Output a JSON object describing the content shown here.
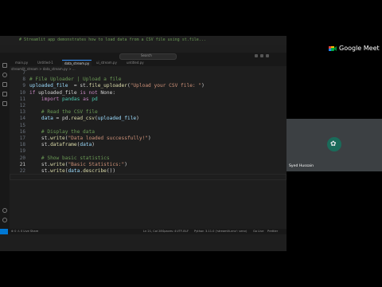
{
  "meet": {
    "brand": "Google Meet",
    "participant_name": "Syed Hussain"
  },
  "vscode": {
    "top_comment": "# Streamlit app demonstrates how to load data from a CSV file using st.file...",
    "command_center": "Search",
    "tabs": [
      "main.py",
      "Untitled-1",
      "data_stream.py",
      "ui_stream.py",
      "untitled.py"
    ],
    "active_tab": 2,
    "breadcrumb": "streamlit_stream > data_stream.py > ...",
    "status": {
      "remote": "",
      "left": "⊗ 0 ⚠ 0   Live Share",
      "position": "Ln 21, Col 28",
      "spaces": "Spaces: 4",
      "encoding": "UTF-8",
      "eol": "LF",
      "language": "Python",
      "interpreter": "3.11.0 ('streamlit-env': venv)",
      "golive": "Go Live",
      "prettier": "Prettier"
    },
    "lines": [
      {
        "n": "7",
        "tokens": []
      },
      {
        "n": "8",
        "tokens": [
          [
            "c-cm",
            "# File Uploader | Upload a file"
          ]
        ]
      },
      {
        "n": "9",
        "tokens": [
          [
            "c-var",
            "uploaded_file"
          ],
          [
            "",
            "  = st."
          ],
          [
            "c-fn",
            "file_uploader"
          ],
          [
            "",
            "("
          ],
          [
            "c-str",
            "\"Upload your CSV file: \""
          ],
          [
            "",
            ")"
          ]
        ]
      },
      {
        "n": "10",
        "tokens": [
          [
            "c-kw",
            "if"
          ],
          [
            "",
            " uploaded_file "
          ],
          [
            "c-kw",
            "is not"
          ],
          [
            "",
            " None:"
          ]
        ]
      },
      {
        "n": "11",
        "tokens": [
          [
            "",
            "    "
          ],
          [
            "c-kw",
            "import"
          ],
          [
            "",
            " "
          ],
          [
            "c-mod",
            "pandas"
          ],
          [
            "",
            " "
          ],
          [
            "c-kw",
            "as"
          ],
          [
            "",
            " "
          ],
          [
            "c-mod",
            "pd"
          ]
        ]
      },
      {
        "n": "12",
        "tokens": []
      },
      {
        "n": "13",
        "tokens": [
          [
            "",
            "    "
          ],
          [
            "c-cm",
            "# Read the CSV file"
          ]
        ]
      },
      {
        "n": "14",
        "tokens": [
          [
            "",
            "    "
          ],
          [
            "c-var",
            "data"
          ],
          [
            "",
            " = pd."
          ],
          [
            "c-fn",
            "read_csv"
          ],
          [
            "",
            "("
          ],
          [
            "c-var",
            "uploaded_file"
          ],
          [
            "",
            ")"
          ]
        ]
      },
      {
        "n": "15",
        "tokens": []
      },
      {
        "n": "16",
        "tokens": [
          [
            "",
            "    "
          ],
          [
            "c-cm",
            "# Display the data"
          ]
        ]
      },
      {
        "n": "17",
        "tokens": [
          [
            "",
            "    st."
          ],
          [
            "c-fn",
            "write"
          ],
          [
            "",
            "("
          ],
          [
            "c-str",
            "\"Data loaded successfully!\""
          ],
          [
            "",
            ")"
          ]
        ]
      },
      {
        "n": "18",
        "tokens": [
          [
            "",
            "    st."
          ],
          [
            "c-fn",
            "dataframe"
          ],
          [
            "",
            "("
          ],
          [
            "c-var",
            "data"
          ],
          [
            "",
            ")"
          ]
        ]
      },
      {
        "n": "19",
        "tokens": []
      },
      {
        "n": "20",
        "tokens": [
          [
            "",
            "    "
          ],
          [
            "c-cm",
            "# Show basic statistics"
          ]
        ]
      },
      {
        "n": "21",
        "tokens": [
          [
            "",
            "    st."
          ],
          [
            "c-fn",
            "write"
          ],
          [
            "",
            "("
          ],
          [
            "c-str",
            "\"Basic Statistics:\""
          ],
          [
            "",
            ")"
          ]
        ]
      },
      {
        "n": "22",
        "tokens": [
          [
            "",
            "    st."
          ],
          [
            "c-fn",
            "write"
          ],
          [
            "",
            "("
          ],
          [
            "c-var",
            "data"
          ],
          [
            "",
            "."
          ],
          [
            "c-fn",
            "describe"
          ],
          [
            "",
            "())"
          ]
        ]
      }
    ]
  }
}
